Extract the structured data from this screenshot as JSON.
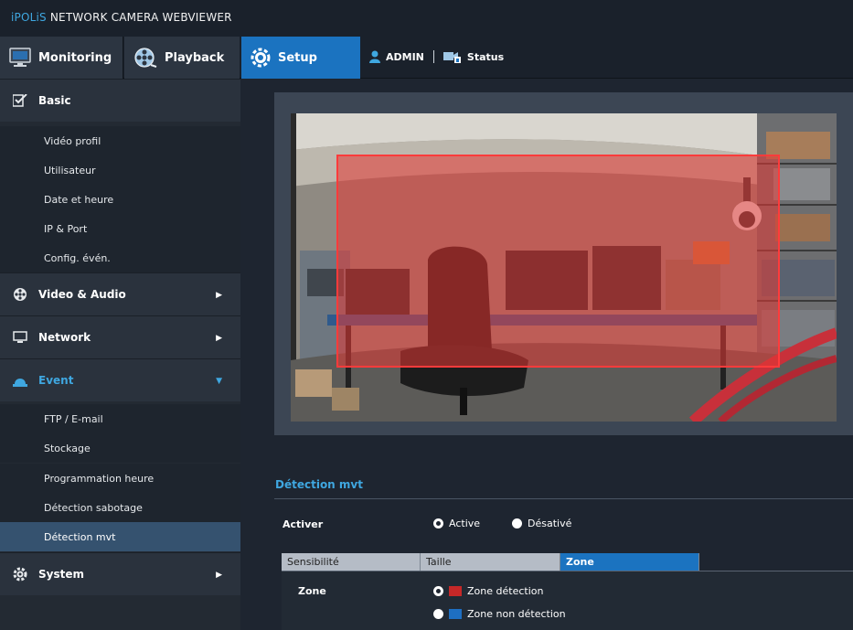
{
  "app": {
    "brand_prefix": "iPOLiS",
    "brand_rest": " NETWORK CAMERA WEBVIEWER"
  },
  "nav": {
    "monitoring": "Monitoring",
    "playback": "Playback",
    "setup": "Setup",
    "user": "ADMIN",
    "status": "Status"
  },
  "sidebar": {
    "basic": {
      "label": "Basic",
      "items": [
        "Vidéo profil",
        "Utilisateur",
        "Date et heure",
        "IP & Port",
        "Config. évén."
      ]
    },
    "video_audio": {
      "label": "Video & Audio"
    },
    "network": {
      "label": "Network"
    },
    "event": {
      "label": "Event",
      "items": [
        "FTP / E-mail",
        "Stockage",
        "Programmation heure",
        "Détection sabotage",
        "Détection mvt"
      ],
      "active_index": 4
    },
    "system": {
      "label": "System"
    }
  },
  "main": {
    "section_title": "Détection mvt",
    "activer": {
      "label": "Activer",
      "options": [
        "Active",
        "Désativé"
      ],
      "selected": 0
    },
    "tabs": [
      "Sensibilité",
      "Taille",
      "Zone"
    ],
    "active_tab": 2,
    "zone": {
      "label": "Zone",
      "options": [
        "Zone détection",
        "Zone non détection"
      ],
      "selected": 0
    }
  },
  "colors": {
    "accent_blue": "#1b73c0",
    "title_blue": "#3fa7e0",
    "detection_zone": "#c62828",
    "non_detection_zone": "#1e6fc2"
  }
}
